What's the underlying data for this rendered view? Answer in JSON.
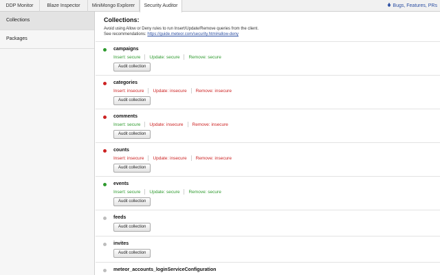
{
  "tabs": [
    {
      "label": "DDP Monitor"
    },
    {
      "label": "Blaze Inspector"
    },
    {
      "label": "MiniMongo Explorer"
    },
    {
      "label": "Security Auditor"
    }
  ],
  "top_link": {
    "label": "Bugs, Features, PRs",
    "icon": "bug-icon"
  },
  "sidebar": {
    "items": [
      {
        "label": "Collections"
      },
      {
        "label": "Packages"
      }
    ]
  },
  "main": {
    "title": "Collections:",
    "description": "Avoid using Allow or Deny rules to run Insert/Update/Remove queries from the client.",
    "recommendation_prefix": "See recommendations:",
    "recommendation_link": "https://guide.meteor.com/security.html#allow-deny",
    "audit_label": "Audit collection",
    "collections": [
      {
        "name": "campaigns",
        "status_color": "#2e9a2e",
        "permissions": [
          {
            "text": "Insert: secure",
            "state": "secure"
          },
          {
            "text": "Update: secure",
            "state": "secure"
          },
          {
            "text": "Remove: secure",
            "state": "secure"
          }
        ]
      },
      {
        "name": "categories",
        "status_color": "#cc2222",
        "permissions": [
          {
            "text": "Insert: insecure",
            "state": "insecure"
          },
          {
            "text": "Update: insecure",
            "state": "insecure"
          },
          {
            "text": "Remove: insecure",
            "state": "insecure"
          }
        ]
      },
      {
        "name": "comments",
        "status_color": "#cc2222",
        "permissions": [
          {
            "text": "Insert: secure",
            "state": "secure"
          },
          {
            "text": "Update: insecure",
            "state": "insecure"
          },
          {
            "text": "Remove: insecure",
            "state": "insecure"
          }
        ]
      },
      {
        "name": "counts",
        "status_color": "#cc2222",
        "permissions": [
          {
            "text": "Insert: insecure",
            "state": "insecure"
          },
          {
            "text": "Update: insecure",
            "state": "insecure"
          },
          {
            "text": "Remove: insecure",
            "state": "insecure"
          }
        ]
      },
      {
        "name": "events",
        "status_color": "#2e9a2e",
        "permissions": [
          {
            "text": "Insert: secure",
            "state": "secure"
          },
          {
            "text": "Update: secure",
            "state": "secure"
          },
          {
            "text": "Remove: secure",
            "state": "secure"
          }
        ]
      },
      {
        "name": "feeds",
        "status_color": "#bdbdbd",
        "permissions": []
      },
      {
        "name": "invites",
        "status_color": "#bdbdbd",
        "permissions": []
      },
      {
        "name": "meteor_accounts_loginServiceConfiguration",
        "status_color": "#bdbdbd",
        "permissions": []
      }
    ]
  }
}
